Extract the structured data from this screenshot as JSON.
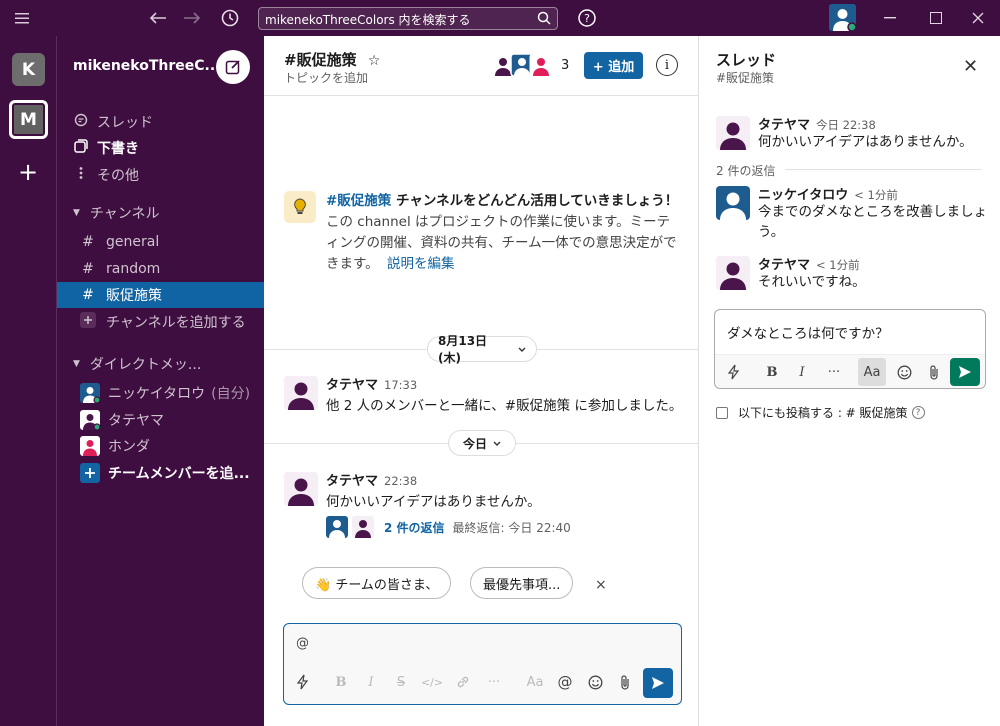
{
  "titlebar": {
    "search_text": "mikenekoThreeColors 内を検索する",
    "icons": [
      "menu-icon",
      "back-arrow-icon",
      "forward-arrow-icon",
      "history-icon",
      "search-icon",
      "help-icon"
    ]
  },
  "rail": {
    "workspaces": [
      {
        "letter": "K",
        "active": false
      },
      {
        "letter": "M",
        "active": true
      }
    ],
    "add": "+"
  },
  "sidebar": {
    "workspace_name": "mikenekoThreeC...",
    "chevron": "⌄",
    "top_items": [
      {
        "icon": "threads-icon",
        "label": "スレッド"
      },
      {
        "icon": "drafts-icon",
        "label": "下書き"
      },
      {
        "icon": "more-icon",
        "label": "その他"
      }
    ],
    "channels_header": "チャンネル",
    "channels": [
      {
        "label": "general",
        "active": false
      },
      {
        "label": "random",
        "active": false
      },
      {
        "label": "販促施策",
        "active": true
      }
    ],
    "add_channel": "チャンネルを追加する",
    "dm_header": "ダイレクトメッ...",
    "dms": [
      {
        "label": "ニッケイタロウ",
        "suffix": "(自分)",
        "color": "#1e5b8f"
      },
      {
        "label": "タテヤマ",
        "suffix": "",
        "color": "#4a154b"
      },
      {
        "label": "ホンダ",
        "suffix": "",
        "color": "#e01e5a"
      }
    ],
    "add_member": "チームメンバーを追..."
  },
  "channel": {
    "title": "#販促施策",
    "star": "☆",
    "topic": "トピックを追加",
    "member_count": "3",
    "add_label": "+ 追加",
    "info": "i",
    "intro_channel": "#販促施策",
    "intro_title_rest": " チャンネルをどんどん活用していきましょう！",
    "intro_desc": "この channel はプロジェクトの作業に使います。ミーティングの開催、資料の共有、チーム一体での意思決定ができます。",
    "intro_link": "説明を編集",
    "day1": "8月13日 (木)",
    "day2": "今日",
    "messages": [
      {
        "name": "タテヤマ",
        "time": "17:33",
        "body": "他 2 人のメンバーと一緒に、#販促施策 に参加しました。"
      },
      {
        "name": "タテヤマ",
        "time": "22:38",
        "body": "何かいいアイデアはありませんか。",
        "replies": "2 件の返信",
        "last_reply": "最終返信: 今日 22:40"
      }
    ],
    "suggestions": [
      "👋 チームの皆さま、",
      "最優先事項..."
    ],
    "suggest_close": "×",
    "composer_text": "@",
    "composer_tools": [
      "lightning-icon",
      "bold-icon",
      "italic-icon",
      "strike-icon",
      "code-icon",
      "link-icon",
      "ellipsis-icon",
      "format-icon",
      "mention-icon",
      "emoji-icon",
      "attach-icon"
    ]
  },
  "thread": {
    "title": "スレッド",
    "subtitle": "#販促施策",
    "close": "✕",
    "parent": {
      "name": "タテヤマ",
      "time": "今日 22:38",
      "body": "何かいいアイデアはありませんか。"
    },
    "reply_count": "2 件の返信",
    "replies": [
      {
        "name": "ニッケイタロウ",
        "time": "< 1分前",
        "body": "今までのダメなところを改善しましょう。"
      },
      {
        "name": "タテヤマ",
        "time": "< 1分前",
        "body": "それいいですね。"
      }
    ],
    "composer_text": "ダメなところは何ですか？",
    "also_post": "以下にも投稿する : # 販促施策",
    "help": "?"
  }
}
